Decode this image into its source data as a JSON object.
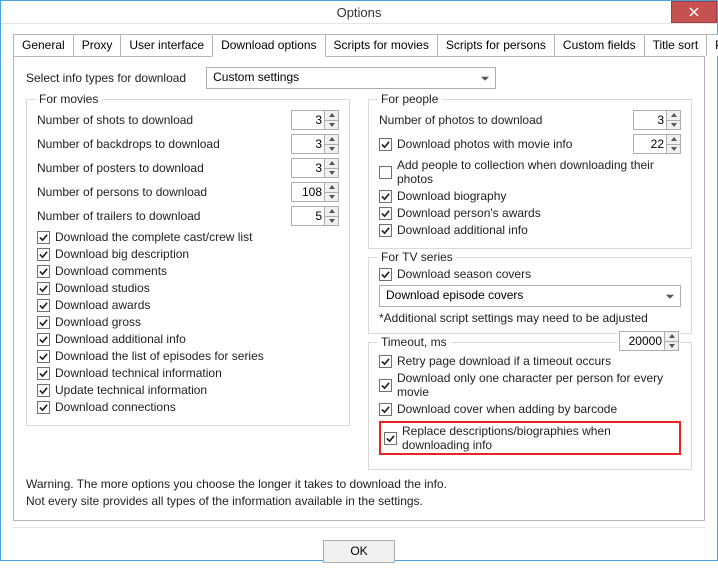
{
  "window": {
    "title": "Options"
  },
  "tabs": [
    "General",
    "Proxy",
    "User interface",
    "Download options",
    "Scripts for movies",
    "Scripts for persons",
    "Custom fields",
    "Title sort",
    "Play options"
  ],
  "active_tab": 3,
  "select_label": "Select info types for download",
  "select_value": "Custom settings",
  "movies": {
    "title": "For movies",
    "shots_label": "Number of shots to download",
    "shots": "3",
    "backdrops_label": "Number of backdrops to download",
    "backdrops": "3",
    "posters_label": "Number of posters to download",
    "posters": "3",
    "persons_label": "Number of persons to download",
    "persons": "108",
    "trailers_label": "Number of trailers to download",
    "trailers": "5",
    "checks": [
      "Download the complete cast/crew list",
      "Download big description",
      "Download comments",
      "Download studios",
      "Download awards",
      "Download gross",
      "Download additional info",
      "Download the list of episodes for series",
      "Download technical information",
      "Update technical information",
      "Download connections"
    ]
  },
  "people": {
    "title": "For people",
    "photos_label": "Number of photos to download",
    "photos": "3",
    "with_movie_label": "Download photos with movie info",
    "with_movie": "22",
    "add_collection_label": "Add people to collection when downloading their photos",
    "biography_label": "Download biography",
    "person_awards_label": "Download person's awards",
    "additional_label": "Download additional info"
  },
  "tv": {
    "title": "For TV series",
    "covers_label": "Download season covers",
    "episode_select": "Download episode covers",
    "note": "*Additional script settings may need to be adjusted"
  },
  "timeout": {
    "label": "Timeout, ms",
    "value": "20000",
    "retry_label": "Retry page download if a timeout occurs",
    "one_char_label": "Download only one character per person for every movie",
    "cover_barcode_label": "Download cover when adding by barcode",
    "replace_label": "Replace descriptions/biographies when downloading info"
  },
  "warning_line1": "Warning. The more options you choose the longer it takes to download the info.",
  "warning_line2": "Not every site provides all types of the information available in the settings.",
  "ok": "OK"
}
